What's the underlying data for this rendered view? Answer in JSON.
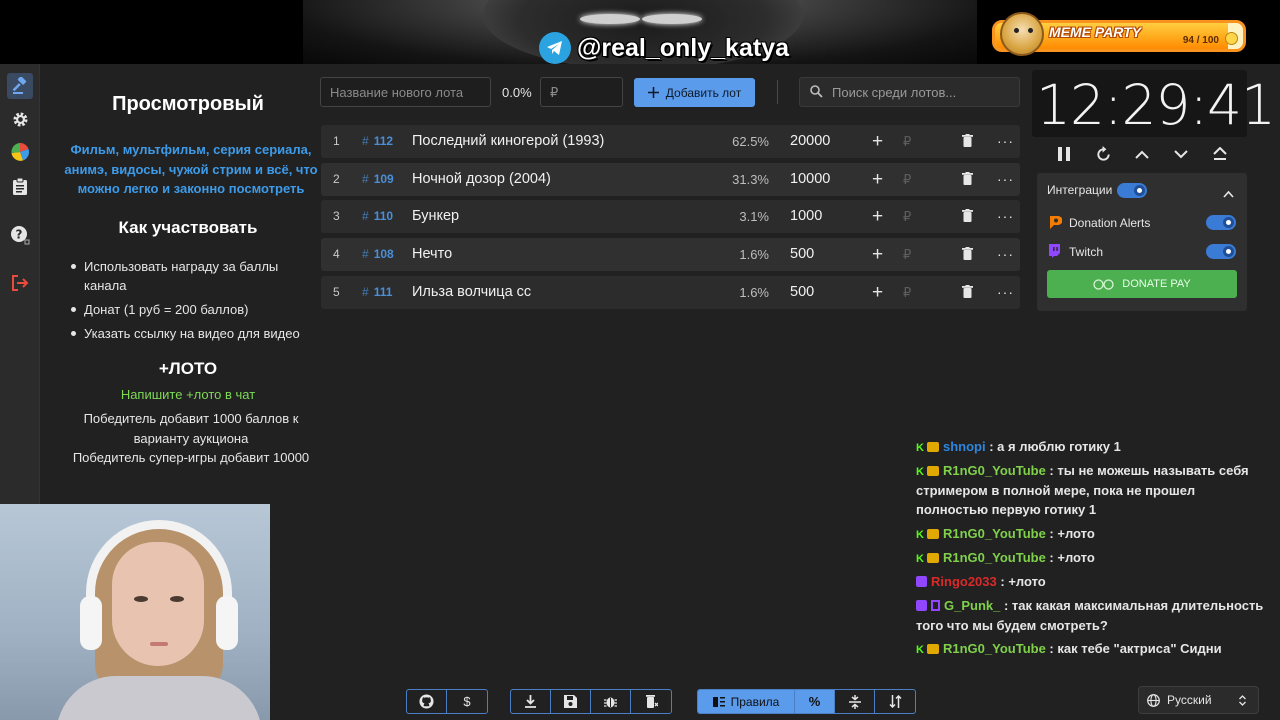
{
  "banner": {
    "telegram_handle": "@real_only_katya"
  },
  "meme_party": {
    "title": "MEME PARTY",
    "count": "94 / 100",
    "progress_fraction": 0.94
  },
  "sidebar": {
    "items": [
      "auction-icon",
      "gear-icon",
      "pie-chart-icon",
      "clipboard-icon",
      "help-icon",
      "logout-icon"
    ]
  },
  "info": {
    "title": "Просмотровый",
    "description": "Фильм, мультфильм, серия сериала, анимэ, видосы, чужой стрим и всё, что можно легко и законно посмотреть",
    "how_title": "Как участвовать",
    "bullets": [
      "Использовать награду за баллы канала",
      "Донат (1 руб = 200 баллов)",
      "Указать ссылку на видео для видео"
    ],
    "loto_title": "+ЛОТО",
    "loto_note": "Напишите +лото в чат",
    "winner_text": "Победитель добавит 1000 баллов к варианту аукциона",
    "super_text": "Победитель супер-игры добавит 10000"
  },
  "controls": {
    "lot_name_placeholder": "Название нового лота",
    "percent": "0.0%",
    "amount_placeholder": "₽",
    "add_button": "Добавить лот",
    "search_placeholder": "Поиск среди лотов..."
  },
  "lots": [
    {
      "num": "1",
      "id": "112",
      "name": "Последний киногерой (1993)",
      "pct": "62.5%",
      "amount": "20000"
    },
    {
      "num": "2",
      "id": "109",
      "name": "Ночной дозор (2004)",
      "pct": "31.3%",
      "amount": "10000"
    },
    {
      "num": "3",
      "id": "110",
      "name": "Бункер",
      "pct": "3.1%",
      "amount": "1000"
    },
    {
      "num": "4",
      "id": "108",
      "name": "Нечто",
      "pct": "1.6%",
      "amount": "500"
    },
    {
      "num": "5",
      "id": "111",
      "name": "Ильза волчица сс",
      "pct": "1.6%",
      "amount": "500"
    }
  ],
  "lot_labels": {
    "plus": "+",
    "rub": "₽",
    "more": "···",
    "hash": "#"
  },
  "timer": {
    "value": "12:29:41"
  },
  "integrations": {
    "label": "Интеграции",
    "items": [
      "Donation Alerts",
      "Twitch"
    ],
    "donate_button": "DONATE PAY"
  },
  "chat": [
    {
      "user": "shnopi",
      "text": "а я люблю готику 1"
    },
    {
      "user": "R1nG0_YouTube",
      "text": "ты не можешь называть себя стримером в полной мере, пока не прошел полностью первую готику 1"
    },
    {
      "user": "R1nG0_YouTube",
      "text": "+лото"
    },
    {
      "user": "R1nG0_YouTube",
      "text": "+лото"
    },
    {
      "user": "Ringo2033",
      "text": "+лото"
    },
    {
      "user": "G_Punk_",
      "text": "так какая максимальная длительность того что мы будем смотреть?"
    },
    {
      "user": "R1nG0_YouTube",
      "text": "как тебе \"актриса\" Сидни Суини?"
    }
  ],
  "chat_sep": " : ",
  "toolbar": {
    "rules_label": "Правила",
    "percent_label": "%",
    "donate_label": "$"
  },
  "language": {
    "selected": "Русский"
  }
}
